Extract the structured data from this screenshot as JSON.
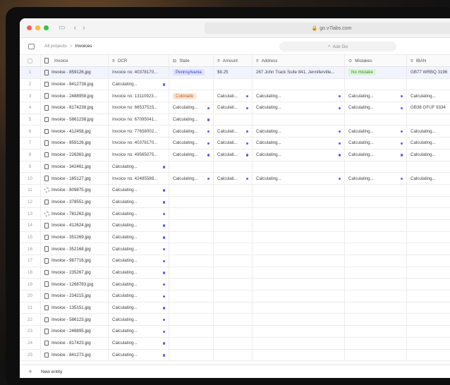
{
  "browser": {
    "url": "go.v7labs.com",
    "traffic_lights": [
      "#fe5f57",
      "#febc2e",
      "#28c840"
    ]
  },
  "toolbar": {
    "breadcrumb_root": "All projects",
    "breadcrumb_current": "Invoices",
    "ask_placeholder": "Ask Go"
  },
  "columns": {
    "invoice": "Invoice",
    "ocr": "OCR",
    "state": "State",
    "amount": "Amount",
    "address": "Address",
    "mistakes": "Mistakes",
    "iban": "IBAN"
  },
  "colors": {
    "accent": "#5b5bf0",
    "state_pennsylvania_bg": "#dfe3ff",
    "state_colorado_bg": "#fde3d2",
    "no_mistake_bg": "#dcf5d6"
  },
  "rows": [
    {
      "n": "1",
      "invoice": "Invoice - 859126.jpg",
      "ocr": "Invoice no: 40378170...",
      "state": "Pennsylvania",
      "amount": "$8.25",
      "address": "267 John Track Suite 841, Jenniferville...",
      "mistakes": "No mistake",
      "iban": "GB77 WRBQ 3196"
    },
    {
      "n": "2",
      "invoice": "Invoice - 8412738.jpg",
      "ocr": "Calculating..."
    },
    {
      "n": "3",
      "invoice": "Invoice - 2488958.jpg",
      "ocr": "Invoice no: 13110923...",
      "state": "Colorado",
      "amount": "Calculati...",
      "address": "Calculating...",
      "mistakes": "Calculating...",
      "iban": "Calculating..."
    },
    {
      "n": "4",
      "invoice": "Invoice - 8174238.jpg",
      "ocr": "Invoice no: 66537515...",
      "state": "Calculating...",
      "amount": "Calculati...",
      "address": "Calculating...",
      "mistakes": "Calculating...",
      "iban": "GB36 GFUF 9334"
    },
    {
      "n": "5",
      "invoice": "Invoice - 5861238.jpg",
      "ocr": "Invoice no: 67095041...",
      "state": "Calculating..."
    },
    {
      "n": "6",
      "invoice": "Invoice - 412458.jpg",
      "ocr": "Invoice no: 77658002...",
      "state": "Calculating...",
      "amount": "Calculati...",
      "address": "Calculating...",
      "mistakes": "Calculating...",
      "iban": "Calculating..."
    },
    {
      "n": "7",
      "invoice": "Invoice - 859126.jpg",
      "ocr": "Invoice no: 40378170...",
      "state": "Calculating...",
      "amount": "Calculati...",
      "address": "Calculating...",
      "mistakes": "Calculating...",
      "iban": "Calculating..."
    },
    {
      "n": "8",
      "invoice": "Invoice - 226363.jpg",
      "ocr": "Invoice no: 49565075...",
      "state": "Calculating...",
      "amount": "Calculati...",
      "address": "Calculating...",
      "mistakes": "Calculating...",
      "iban": "Calculating..."
    },
    {
      "n": "9",
      "invoice": "Invoice - 342461.jpg",
      "ocr": "Calculating..."
    },
    {
      "n": "10",
      "invoice": "Invoice - 165127.jpg",
      "ocr": "Invoice no: 42485588...",
      "state": "Calculating...",
      "amount": "Calculati...",
      "address": "Calculating...",
      "mistakes": "Calculating...",
      "iban": "Calculating..."
    },
    {
      "n": "11",
      "invoice": "Invoice - 809875.jpg",
      "ocr": "Calculating...",
      "icon": "spinner"
    },
    {
      "n": "12",
      "invoice": "Invoice - 378551.jpg",
      "ocr": "Calculating..."
    },
    {
      "n": "13",
      "invoice": "Invoice - 781263.jpg",
      "ocr": "Calculating...",
      "icon": "spinner"
    },
    {
      "n": "14",
      "invoice": "Invoice - 412624.jpg",
      "ocr": "Calculating..."
    },
    {
      "n": "15",
      "invoice": "Invoice - 351269.jpg",
      "ocr": "Calculating..."
    },
    {
      "n": "16",
      "invoice": "Invoice - 352168.jpg",
      "ocr": "Calculating..."
    },
    {
      "n": "17",
      "invoice": "Invoice - 987716.jpg",
      "ocr": "Calculating..."
    },
    {
      "n": "18",
      "invoice": "Invoice - 235267.jpg",
      "ocr": "Calculating..."
    },
    {
      "n": "19",
      "invoice": "Invoice - 1268783.jpg",
      "ocr": "Calculating..."
    },
    {
      "n": "20",
      "invoice": "Invoice - 234215.jpg",
      "ocr": "Calculating..."
    },
    {
      "n": "21",
      "invoice": "Invoice - 135151.jpg",
      "ocr": "Calculating..."
    },
    {
      "n": "22",
      "invoice": "Invoice - 586123.jpg",
      "ocr": "Calculating..."
    },
    {
      "n": "23",
      "invoice": "Invoice - 248895.jpg",
      "ocr": "Calculating..."
    },
    {
      "n": "24",
      "invoice": "Invoice - 817423.jpg",
      "ocr": "Calculating..."
    },
    {
      "n": "25",
      "invoice": "Invoice - 841273.jpg",
      "ocr": "Calculating..."
    }
  ],
  "footer": {
    "new_entity": "New entity"
  }
}
